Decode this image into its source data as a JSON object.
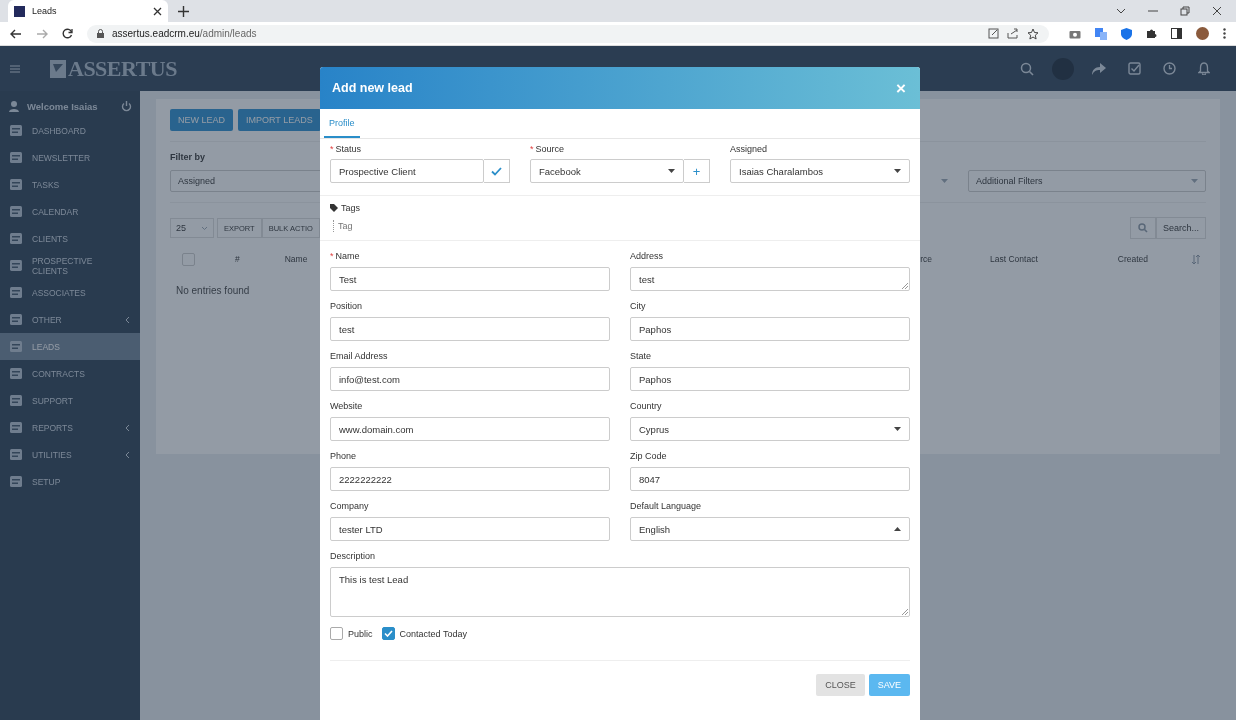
{
  "browser": {
    "tab_title": "Leads",
    "url_host": "assertus.eadcrm.eu",
    "url_path": "/admin/leads"
  },
  "header": {
    "logo": "ASSERTUS"
  },
  "sidebar": {
    "welcome": "Welcome Isaias",
    "items": [
      {
        "label": "DASHBOARD",
        "selected": false,
        "expandable": false
      },
      {
        "label": "NEWSLETTER",
        "selected": false,
        "expandable": false
      },
      {
        "label": "TASKS",
        "selected": false,
        "expandable": false
      },
      {
        "label": "CALENDAR",
        "selected": false,
        "expandable": false
      },
      {
        "label": "CLIENTS",
        "selected": false,
        "expandable": false
      },
      {
        "label": "PROSPECTIVE CLIENTS",
        "selected": false,
        "expandable": false
      },
      {
        "label": "ASSOCIATES",
        "selected": false,
        "expandable": false
      },
      {
        "label": "OTHER",
        "selected": false,
        "expandable": true
      },
      {
        "label": "LEADS",
        "selected": true,
        "expandable": false
      },
      {
        "label": "CONTRACTS",
        "selected": false,
        "expandable": false
      },
      {
        "label": "SUPPORT",
        "selected": false,
        "expandable": false
      },
      {
        "label": "REPORTS",
        "selected": false,
        "expandable": true
      },
      {
        "label": "UTILITIES",
        "selected": false,
        "expandable": true
      },
      {
        "label": "SETUP",
        "selected": false,
        "expandable": false
      }
    ]
  },
  "page": {
    "buttons": [
      "NEW LEAD",
      "IMPORT LEADS"
    ],
    "filter_label": "Filter by",
    "filter_left": "Assigned",
    "filter_right": "Additional Filters",
    "page_length": "25",
    "select_all_checked": false,
    "toolbar": [
      "EXPORT",
      "BULK ACTIO"
    ],
    "search_placeholder": "Search...",
    "columns_left": [
      "#",
      "Name"
    ],
    "columns_right": [
      "rce",
      "Last Contact",
      "Created"
    ],
    "empty": "No entries found"
  },
  "modal": {
    "title": "Add new lead",
    "close": "×",
    "tabs": [
      {
        "label": "Profile",
        "selected": true
      }
    ],
    "status": {
      "label": "Status",
      "required_mark": "*",
      "value": "Prospective Client"
    },
    "source": {
      "label": "Source",
      "required_mark": "*",
      "value": "Facebook",
      "add": "+"
    },
    "assigned": {
      "label": "Assigned",
      "value": "Isaias Charalambos"
    },
    "tags": {
      "label": "Tags",
      "placeholder": "Tag"
    },
    "fields": [
      {
        "label": "Name",
        "required_mark": "*",
        "value": "Test",
        "kind": "text"
      },
      {
        "label": "Address",
        "value": "test",
        "kind": "textarea"
      },
      {
        "label": "Position",
        "value": "test",
        "kind": "text"
      },
      {
        "label": "City",
        "value": "Paphos",
        "kind": "text"
      },
      {
        "label": "Email Address",
        "value": "info@test.com",
        "kind": "text"
      },
      {
        "label": "State",
        "value": "Paphos",
        "kind": "text"
      },
      {
        "label": "Website",
        "value": "www.domain.com",
        "kind": "text"
      },
      {
        "label": "Country",
        "value": "Cyprus",
        "kind": "select",
        "expanded": false
      },
      {
        "label": "Phone",
        "value": "2222222222",
        "kind": "text"
      },
      {
        "label": "Zip Code",
        "value": "8047",
        "kind": "text"
      },
      {
        "label": "Company",
        "value": "tester LTD",
        "kind": "text"
      },
      {
        "label": "Default Language",
        "value": "English",
        "kind": "select",
        "expanded": true
      }
    ],
    "description": {
      "label": "Description",
      "value": "This is test Lead"
    },
    "checkboxes": [
      {
        "label": "Public",
        "checked": false
      },
      {
        "label": "Contacted Today",
        "checked": true
      }
    ],
    "buttons": [
      {
        "label": "CLOSE",
        "kind": "secondary"
      },
      {
        "label": "SAVE",
        "kind": "primary"
      }
    ]
  }
}
